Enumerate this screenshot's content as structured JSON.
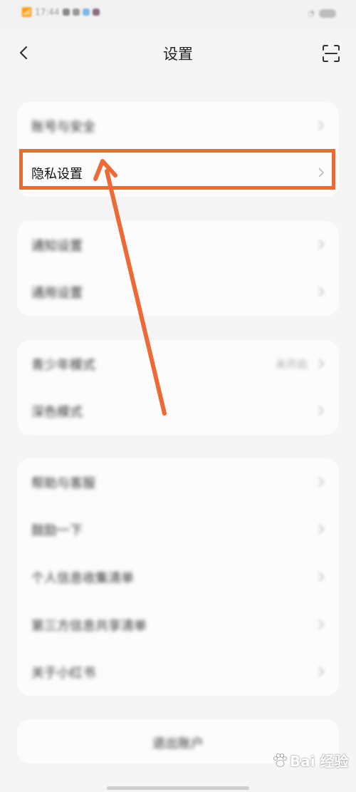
{
  "status_bar": {
    "time": "17:44"
  },
  "header": {
    "title": "设置"
  },
  "groups": [
    {
      "items": [
        {
          "label": "账号与安全"
        },
        {
          "label": "隐私设置"
        }
      ]
    },
    {
      "items": [
        {
          "label": "通知设置"
        },
        {
          "label": "通用设置"
        }
      ]
    },
    {
      "items": [
        {
          "label": "青少年模式",
          "value": "未开启"
        },
        {
          "label": "深色模式"
        }
      ]
    },
    {
      "items": [
        {
          "label": "帮助与客服"
        },
        {
          "label": "鼓励一下"
        },
        {
          "label": "个人信息收集清单"
        },
        {
          "label": "第三方信息共享清单"
        },
        {
          "label": "关于小红书"
        }
      ]
    }
  ],
  "logout": {
    "label": "退出账户"
  },
  "annotation": {
    "highlight_color": "#ee6a35"
  },
  "watermark": {
    "text": "Bai 经验",
    "icon": "paw-icon"
  },
  "colors": {
    "background": "#f5f5f5",
    "card": "#fcfcfc"
  }
}
